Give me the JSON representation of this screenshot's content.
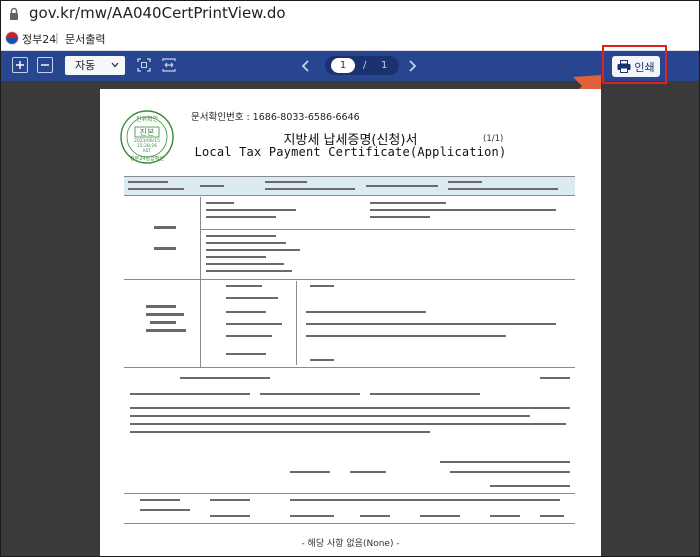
{
  "browser": {
    "url": "gov.kr/mw/AA040CertPrintView.do"
  },
  "titlebar": {
    "site_name": "정부24",
    "separator": "|",
    "page_name": "문서출력"
  },
  "toolbar": {
    "zoom_value": "자동",
    "current_page": "1",
    "page_separator": "/",
    "total_pages": "1",
    "print_label": "인쇄"
  },
  "document": {
    "confirm_number": "문서확인번호 : 1686-8033-6586-6646",
    "title_ko": "지방세 납세증명(신청)서",
    "title_en": "Local Tax Payment Certificate(Application)",
    "page_count": "(1/1)",
    "none_text": "- 해당 사항 없음(None) -",
    "stamp": {
      "top_text": "진위확인",
      "center_text": "진본",
      "date": "2023/06/15",
      "time": "15:28:26",
      "code": "KST",
      "bottom_text": "정부24발급확인"
    }
  },
  "colors": {
    "toolbar_bg": "#27468f",
    "viewer_bg": "#3a3a3a",
    "highlight": "#e02020",
    "arrow": "#e0603c",
    "stamp": "#3a8a3a"
  }
}
